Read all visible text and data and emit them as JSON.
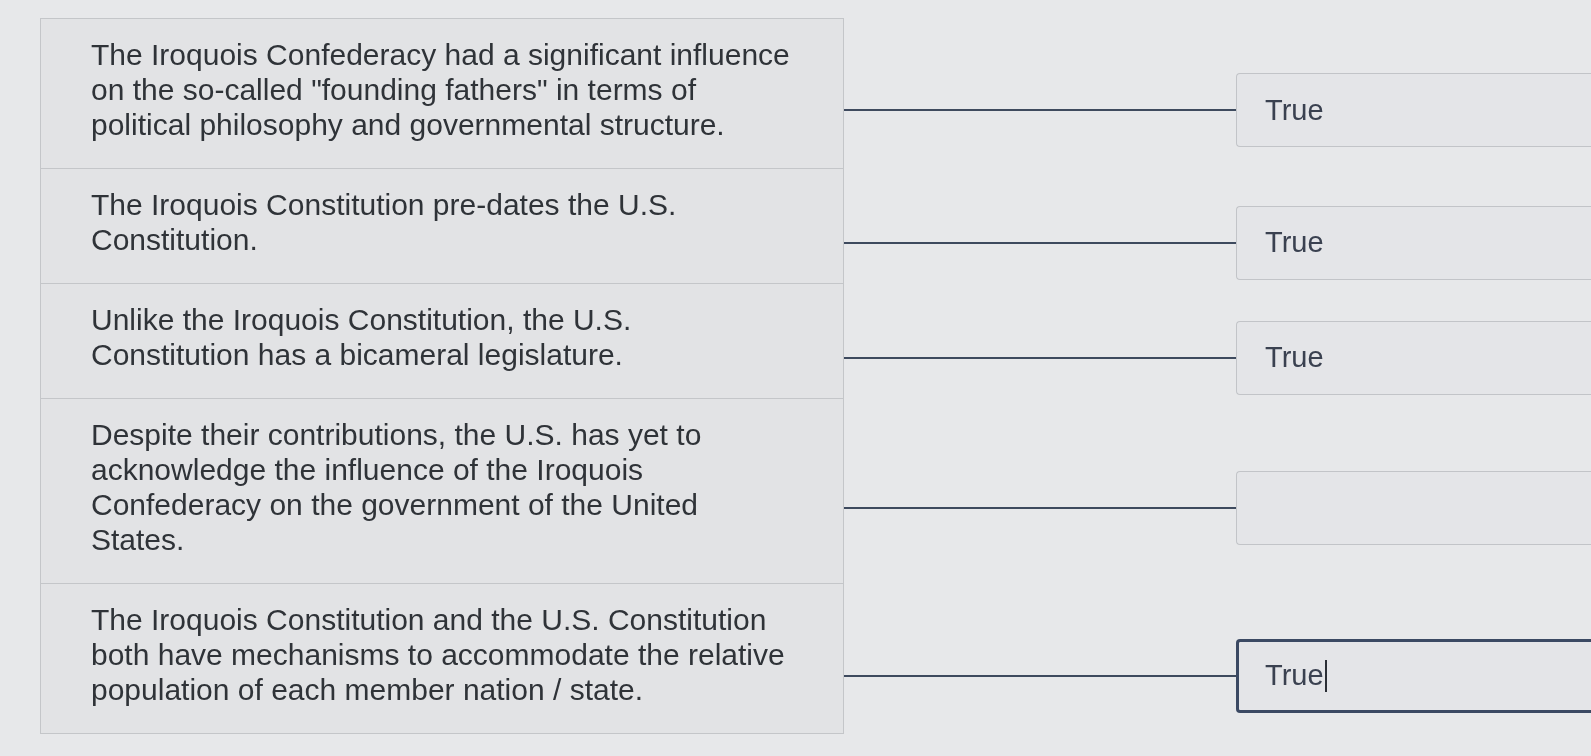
{
  "items": [
    {
      "statement": "The Iroquois Confederacy had a significant influence on the so-called \"founding fathers\" in terms of political philosophy and governmental structure.",
      "answer": "True",
      "focused": false
    },
    {
      "statement": "The Iroquois Constitution pre-dates the U.S. Constitution.",
      "answer": "True",
      "focused": false
    },
    {
      "statement": "Unlike the Iroquois Constitution, the U.S. Constitution has a bicameral legislature.",
      "answer": "True",
      "focused": false
    },
    {
      "statement": "Despite their contributions, the U.S. has yet to acknowledge the influence of the Iroquois Confederacy on the government of the United States.",
      "focused": false
    },
    {
      "statement": "The Iroquois Constitution and the U.S. Constitution both have mechanisms to accommodate the relative population of each member nation / state.",
      "answer": "True",
      "focused": true
    }
  ]
}
